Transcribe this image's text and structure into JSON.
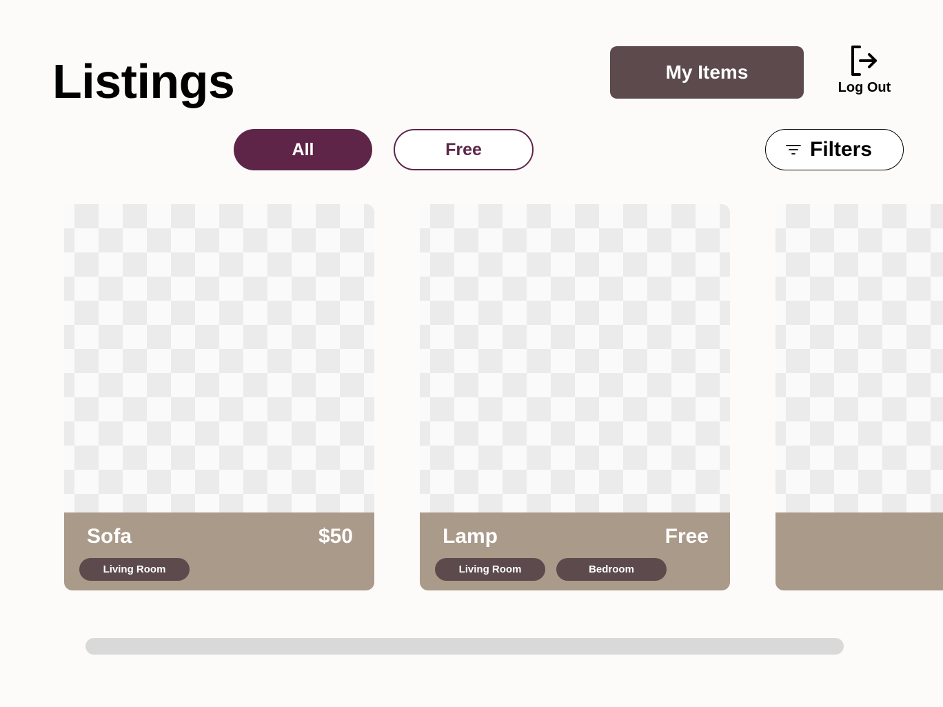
{
  "header": {
    "title": "Listings",
    "my_items_label": "My Items",
    "logout_label": "Log Out",
    "logout_icon": "logout-icon"
  },
  "filters": {
    "tabs": [
      {
        "label": "All",
        "selected": true
      },
      {
        "label": "Free",
        "selected": false
      }
    ],
    "filters_label": "Filters",
    "filters_icon": "filter-lines-icon"
  },
  "listings": [
    {
      "name": "Sofa",
      "price": "$50",
      "tags": [
        "Living Room"
      ]
    },
    {
      "name": "Lamp",
      "price": "Free",
      "tags": [
        "Living Room",
        "Bedroom"
      ]
    },
    {
      "name": "",
      "price": "",
      "tags": []
    }
  ],
  "colors": {
    "background": "#fcfbf9",
    "accent": "#5e2549",
    "button_dark": "#5c4a4c",
    "card_footer": "#aa9a8a",
    "scrollbar": "#d9d9d9"
  }
}
